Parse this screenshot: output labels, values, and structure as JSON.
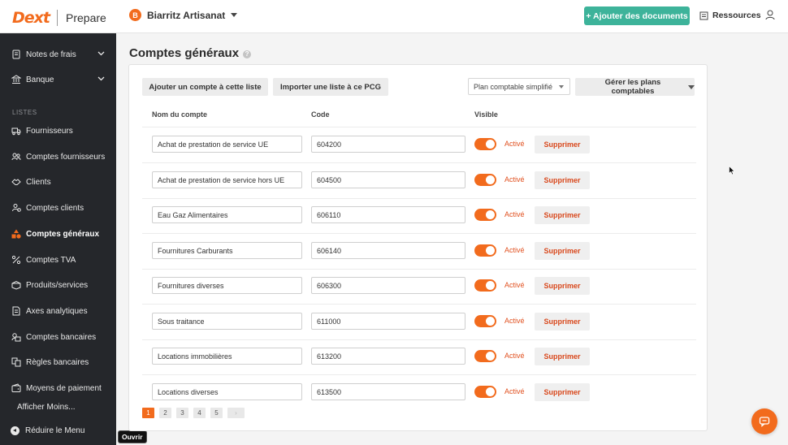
{
  "app": {
    "logo": "Dext",
    "product": "Prepare",
    "company_initial": "B",
    "company_name": "Biarritz Artisanat",
    "add_documents": "+ Ajouter des documents",
    "resources": "Ressources"
  },
  "colors": {
    "accent": "#f26b1d",
    "primary_button": "#3db39a",
    "sidebar": "#25272b"
  },
  "sidebar": {
    "top_items": [
      {
        "label": "Notes de frais",
        "icon": "receipt-icon",
        "expandable": true
      },
      {
        "label": "Banque",
        "icon": "bank-icon",
        "expandable": true
      }
    ],
    "section_label": "LISTES",
    "items": [
      {
        "label": "Fournisseurs",
        "icon": "truck-icon"
      },
      {
        "label": "Comptes fournisseurs",
        "icon": "people-icon"
      },
      {
        "label": "Clients",
        "icon": "handshake-icon"
      },
      {
        "label": "Comptes clients",
        "icon": "user-group-icon"
      },
      {
        "label": "Comptes généraux",
        "icon": "shapes-icon",
        "active": true
      },
      {
        "label": "Comptes TVA",
        "icon": "percent-icon"
      },
      {
        "label": "Produits/services",
        "icon": "box-icon"
      },
      {
        "label": "Axes analytiques",
        "icon": "document-icon"
      },
      {
        "label": "Comptes bancaires",
        "icon": "bank-accounts-icon"
      },
      {
        "label": "Règles bancaires",
        "icon": "rules-icon"
      },
      {
        "label": "Moyens de paiement",
        "icon": "wallet-icon"
      }
    ],
    "show_less": "Afficher Moins...",
    "collapse": "Réduire le Menu",
    "tooltip": "Ouvrir"
  },
  "page": {
    "title": "Comptes généraux",
    "help": "?",
    "add_account": "Ajouter un compte à cette liste",
    "import_list": "Importer une liste à ce PCG",
    "plan_select": "Plan comptable simplifié",
    "manage_plans": "Gérer les plans comptables"
  },
  "table": {
    "headers": [
      "Nom du compte",
      "Code",
      "Visible"
    ],
    "rows": [
      {
        "name": "Achat de prestation de service UE",
        "code": "604200",
        "state": "Activé",
        "action": "Supprimer"
      },
      {
        "name": "Achat de prestation de service hors UE",
        "code": "604500",
        "state": "Activé",
        "action": "Supprimer"
      },
      {
        "name": "Eau Gaz Alimentaires",
        "code": "606110",
        "state": "Activé",
        "action": "Supprimer"
      },
      {
        "name": "Fournitures Carburants",
        "code": "606140",
        "state": "Activé",
        "action": "Supprimer"
      },
      {
        "name": "Fournitures diverses",
        "code": "606300",
        "state": "Activé",
        "action": "Supprimer"
      },
      {
        "name": "Sous traitance",
        "code": "611000",
        "state": "Activé",
        "action": "Supprimer"
      },
      {
        "name": "Locations immobilières",
        "code": "613200",
        "state": "Activé",
        "action": "Supprimer"
      },
      {
        "name": "Locations diverses",
        "code": "613500",
        "state": "Activé",
        "action": "Supprimer"
      }
    ]
  },
  "pagination": {
    "pages": [
      "1",
      "2",
      "3",
      "4",
      "5"
    ],
    "current": "1",
    "next": "›"
  }
}
